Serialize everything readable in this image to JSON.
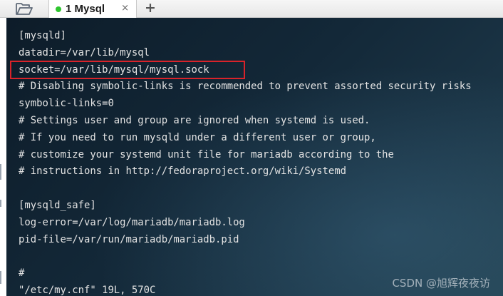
{
  "tabs": [
    {
      "label": "1 Mysql",
      "status_color": "#2ec52e",
      "active": true
    }
  ],
  "tab_close_glyph": "×",
  "new_tab_glyph": "+",
  "icons": {
    "open_folder": "folder-open-icon"
  },
  "terminal": {
    "lines": [
      "[mysqld]",
      "datadir=/var/lib/mysql",
      "socket=/var/lib/mysql/mysql.sock",
      "# Disabling symbolic-links is recommended to prevent assorted security risks",
      "symbolic-links=0",
      "# Settings user and group are ignored when systemd is used.",
      "# If you need to run mysqld under a different user or group,",
      "# customize your systemd unit file for mariadb according to the",
      "# instructions in http://fedoraproject.org/wiki/Systemd",
      "",
      "[mysqld_safe]",
      "log-error=/var/log/mariadb/mariadb.log",
      "pid-file=/var/run/mariadb/mariadb.pid",
      "",
      "#",
      "\"/etc/my.cnf\" 19L, 570C"
    ],
    "highlighted_line_index": 2,
    "highlight_color": "#d8232a"
  },
  "watermark": "CSDN @旭辉夜夜访"
}
